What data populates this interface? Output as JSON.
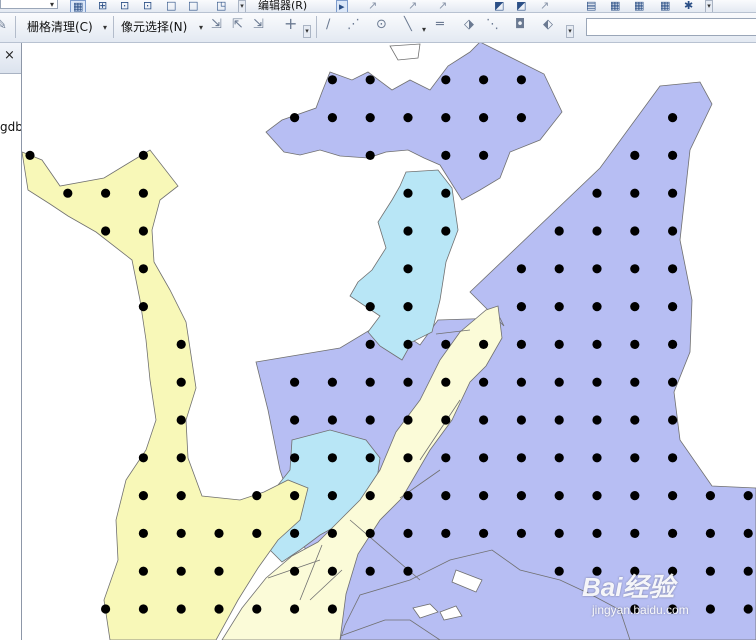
{
  "toolbar_top": {
    "editor_label": "编辑器(R)",
    "editor_dropdown": "▾"
  },
  "toolbar_raster": {
    "raster_cleanup_label": "栅格清理(C)",
    "cell_selection_label": "像元选择(N)",
    "dropdown_arrow": "▾",
    "more_arrow": "▾"
  },
  "icons": {
    "tb1": [
      "▦",
      "⊞",
      "⊡",
      "□",
      "◳",
      "▸",
      "↗",
      "◩",
      "▤",
      "▦",
      "✱"
    ],
    "tb2": [
      "✎",
      "⇲",
      "⇱",
      "⇲",
      "+",
      "∕",
      "⋰",
      "⊙",
      "╲",
      "═",
      "⬗",
      "⋱",
      "◘",
      "⬖"
    ]
  },
  "side_panel": {
    "close_icon": "×",
    "partial_text": "gdb"
  },
  "map": {
    "colors": {
      "background": "#ffffff",
      "yellow_zone": "#f8f8b8",
      "lavender_zone": "#b7bef3",
      "light_blue_zone": "#b8e6f6",
      "cream_zone": "#fbfbd8",
      "point": "#000000",
      "outline": "#707070"
    }
  },
  "watermark": {
    "brand": "Bai经验",
    "url": "jingyan.baidu.com"
  }
}
